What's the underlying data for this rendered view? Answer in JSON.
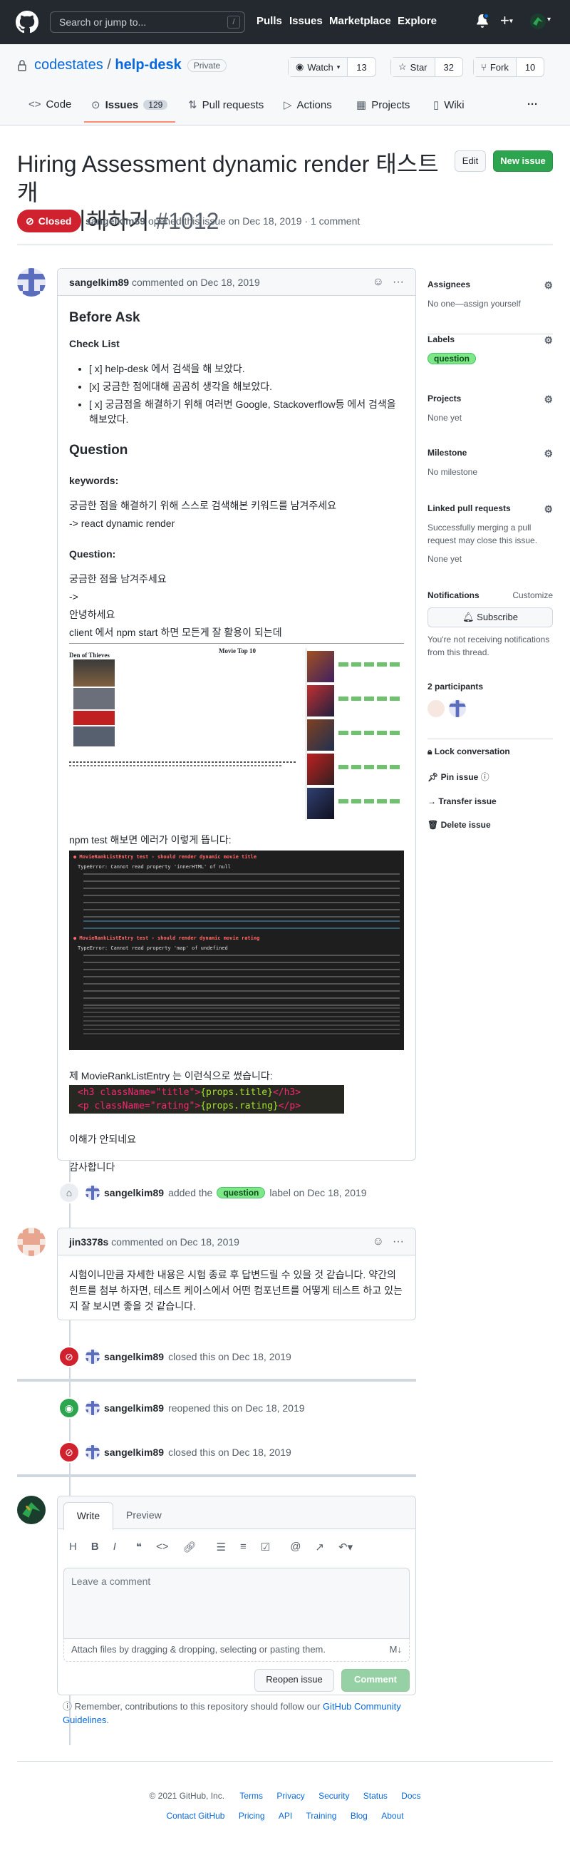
{
  "header": {
    "search_placeholder": "Search or jump to...",
    "kbd": "/",
    "nav": [
      "Pulls",
      "Issues",
      "Marketplace",
      "Explore"
    ]
  },
  "repo": {
    "owner": "codestates",
    "sep": "/",
    "name": "help-desk",
    "visibility": "Private",
    "watch_label": "Watch",
    "watch_count": "13",
    "star_label": "Star",
    "star_count": "32",
    "fork_label": "Fork",
    "fork_count": "10"
  },
  "tabs": {
    "code": "Code",
    "issues": "Issues",
    "issues_count": "129",
    "pulls": "Pull requests",
    "actions": "Actions",
    "projects": "Projects",
    "wiki": "Wiki"
  },
  "issue": {
    "title_line1": "Hiring Assessment dynamic render 태스트 캐",
    "title_line2": "이스 이해하기",
    "number": "#1012",
    "edit": "Edit",
    "new_issue": "New issue",
    "status": "Closed",
    "author": "sangelkim89",
    "meta_rest": "opened this issue on Dec 18, 2019 · 1 comment"
  },
  "comment1": {
    "author": "sangelkim89",
    "action": "commented on Dec 18, 2019",
    "h_before": "Before Ask",
    "h_check": "Check List",
    "check_items": [
      "[ x] help-desk 에서 검색을 해 보았다.",
      "[x] 궁금한 점에대해 곰곰히 생각을 해보았다.",
      "[ x] 궁금점을 해결하기 위해 여러번 Google, Stackoverflow등 에서 검색을 해보았다."
    ],
    "h_question": "Question",
    "keywords_h": "keywords:",
    "keywords_p1": "궁금한 점을 해결하기 위해 스스로 검색해본 키워드를 남겨주세요",
    "keywords_p2": "-> react dynamic render",
    "question_h": "Question:",
    "q1": "궁금한 점을 남겨주세요",
    "q2": "->",
    "q3": "안녕하세요",
    "q4": "client 에서 npm start 하면 모든게 잘 활용이 되는데",
    "img_title": "Movie Top 10",
    "img_left": "Den of Thieves",
    "npm_test": "npm test 해보면 에러가 이렇게 뜹니다:",
    "err1": "● MovieRankListEntry test › should render dynamic movie title",
    "err1_type": "TypeError: Cannot read property 'innerHTML' of null",
    "err2": "● MovieRankListEntry test › should render dynamic movie rating",
    "err2_type": "TypeError: Cannot read property 'map' of undefined",
    "entry_p": "제 MovieRankListEntry 는 이런식으로 썼습니다:",
    "code1_a": "<h3 className=\"title\">",
    "code1_b": "{props.title}",
    "code1_c": "</h3>",
    "code2_a": "<p className=\"rating\">",
    "code2_b": "{props.rating}",
    "code2_c": "</p>",
    "end1": "이해가 안되네요",
    "end2": "감사합니다"
  },
  "event_label": {
    "author": "sangelkim89",
    "pre": "added the",
    "label": "question",
    "post": "label on Dec 18, 2019"
  },
  "comment2": {
    "author": "jin3378s",
    "action": "commented on Dec 18, 2019",
    "body": "시험이니만큼 자세한 내용은 시험 종료 후 답변드릴 수 있을 것 같습니다. 약간의 힌트를 첨부 하자면, 테스트 케이스에서 어떤 컴포넌트를 어떻게 테스트 하고 있는지 잘 보시면 좋을 것 같습니다."
  },
  "event_closed1": {
    "author": "sangelkim89",
    "text": "closed this on Dec 18, 2019"
  },
  "event_reopen": {
    "author": "sangelkim89",
    "text": "reopened this on Dec 18, 2019"
  },
  "event_closed2": {
    "author": "sangelkim89",
    "text": "closed this on Dec 18, 2019"
  },
  "composer": {
    "write": "Write",
    "preview": "Preview",
    "placeholder": "Leave a comment",
    "attach": "Attach files by dragging & dropping, selecting or pasting them.",
    "reopen": "Reopen issue",
    "comment": "Comment",
    "remember": "Remember, contributions to this repository should follow our",
    "guidelines_link": "GitHub Community Guidelines",
    "dot": "."
  },
  "sidebar": {
    "assignees_h": "Assignees",
    "assignees_v": "No one—assign yourself",
    "labels_h": "Labels",
    "label": "question",
    "projects_h": "Projects",
    "projects_v": "None yet",
    "milestone_h": "Milestone",
    "milestone_v": "No milestone",
    "linked_h": "Linked pull requests",
    "linked_p": "Successfully merging a pull request may close this issue.",
    "linked_v": "None yet",
    "notif_h": "Notifications",
    "customize": "Customize",
    "subscribe": "Subscribe",
    "notif_p": "You're not receiving notifications from this thread.",
    "participants": "2 participants",
    "lock": "Lock conversation",
    "pin": "Pin issue",
    "transfer": "Transfer issue",
    "delete": "Delete issue"
  },
  "footer": {
    "copy": "© 2021 GitHub, Inc.",
    "links1": [
      "Terms",
      "Privacy",
      "Security",
      "Status",
      "Docs"
    ],
    "links2": [
      "Contact GitHub",
      "Pricing",
      "API",
      "Training",
      "Blog",
      "About"
    ]
  },
  "colors": {
    "header": "#24292f",
    "green": "#2da44e",
    "red": "#cf222e",
    "link": "#0969da"
  }
}
